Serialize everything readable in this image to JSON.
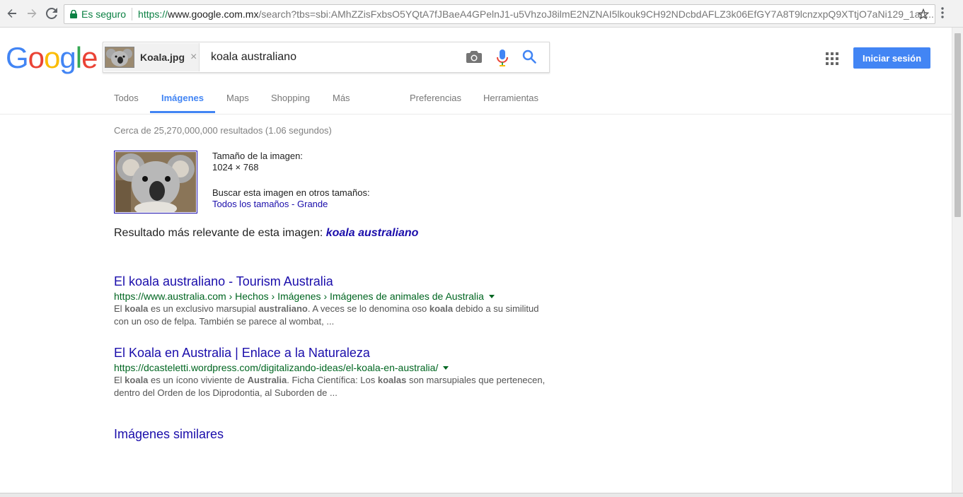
{
  "browser": {
    "secure_label": "Es seguro",
    "url_scheme": "https://",
    "url_host": "www.google.com.mx",
    "url_rest": "/search?tbs=sbi:AMhZZisFxbsO5YQtA7fJBaeA4GPelnJ1-u5VhzoJ8ilmE2NZNAI5lkouk9CH92NDcbdAFLZ3k06EfGY7A8T9lcnzxpQ9XTtjO7aNi129_1an..."
  },
  "header": {
    "logo_letters": [
      "G",
      "o",
      "o",
      "g",
      "l",
      "e"
    ],
    "logo_colors": [
      "#4285f4",
      "#ea4335",
      "#fbbc05",
      "#4285f4",
      "#34a853",
      "#ea4335"
    ],
    "chip_label": "Koala.jpg",
    "chip_close": "×",
    "query": "koala australiano",
    "signin_label": "Iniciar sesión"
  },
  "tabs": [
    {
      "label": "Todos"
    },
    {
      "label": "Imágenes",
      "active": true
    },
    {
      "label": "Maps"
    },
    {
      "label": "Shopping"
    },
    {
      "label": "Más"
    },
    {
      "label": "Preferencias"
    },
    {
      "label": "Herramientas"
    }
  ],
  "stats": "Cerca de 25,270,000,000 resultados (1.06 segundos)",
  "image_info": {
    "size_label": "Tamaño de la imagen:",
    "size_value": "1024 × 768",
    "other_sizes_label": "Buscar esta imagen en otros tamaños:",
    "all_sizes_link": "Todos los tamaños",
    "separator": "-",
    "large_link": "Grande"
  },
  "best_guess": {
    "label": "Resultado más relevante de esta imagen:",
    "query": "koala australiano"
  },
  "results": [
    {
      "title": "El koala australiano - Tourism Australia",
      "url": "https://www.australia.com › Hechos › Imágenes › Imágenes de animales de Australia",
      "snippet_line1_parts": [
        "El ",
        "koala",
        " es un exclusivo marsupial ",
        "australiano",
        ". A veces se lo denomina oso ",
        "koala",
        " debido a su similitud"
      ],
      "snippet_line2": "con un oso de felpa. También se parece al wombat, ..."
    },
    {
      "title": "El Koala en Australia | Enlace a la Naturaleza",
      "url": "https://dcasteletti.wordpress.com/digitalizando-ideas/el-koala-en-australia/",
      "snippet_line1_parts": [
        "El ",
        "koala",
        " es un ícono viviente de ",
        "Australia",
        ". Ficha Científica: Los ",
        "koalas",
        " son marsupiales que pertenecen,"
      ],
      "snippet_line2": "dentro del Orden de los Diprodontia, al Suborden de ..."
    }
  ],
  "similar": {
    "title": "Imágenes similares"
  },
  "colors": {
    "accent": "#4285f4",
    "link": "#1a0dab",
    "url_green": "#006621"
  }
}
